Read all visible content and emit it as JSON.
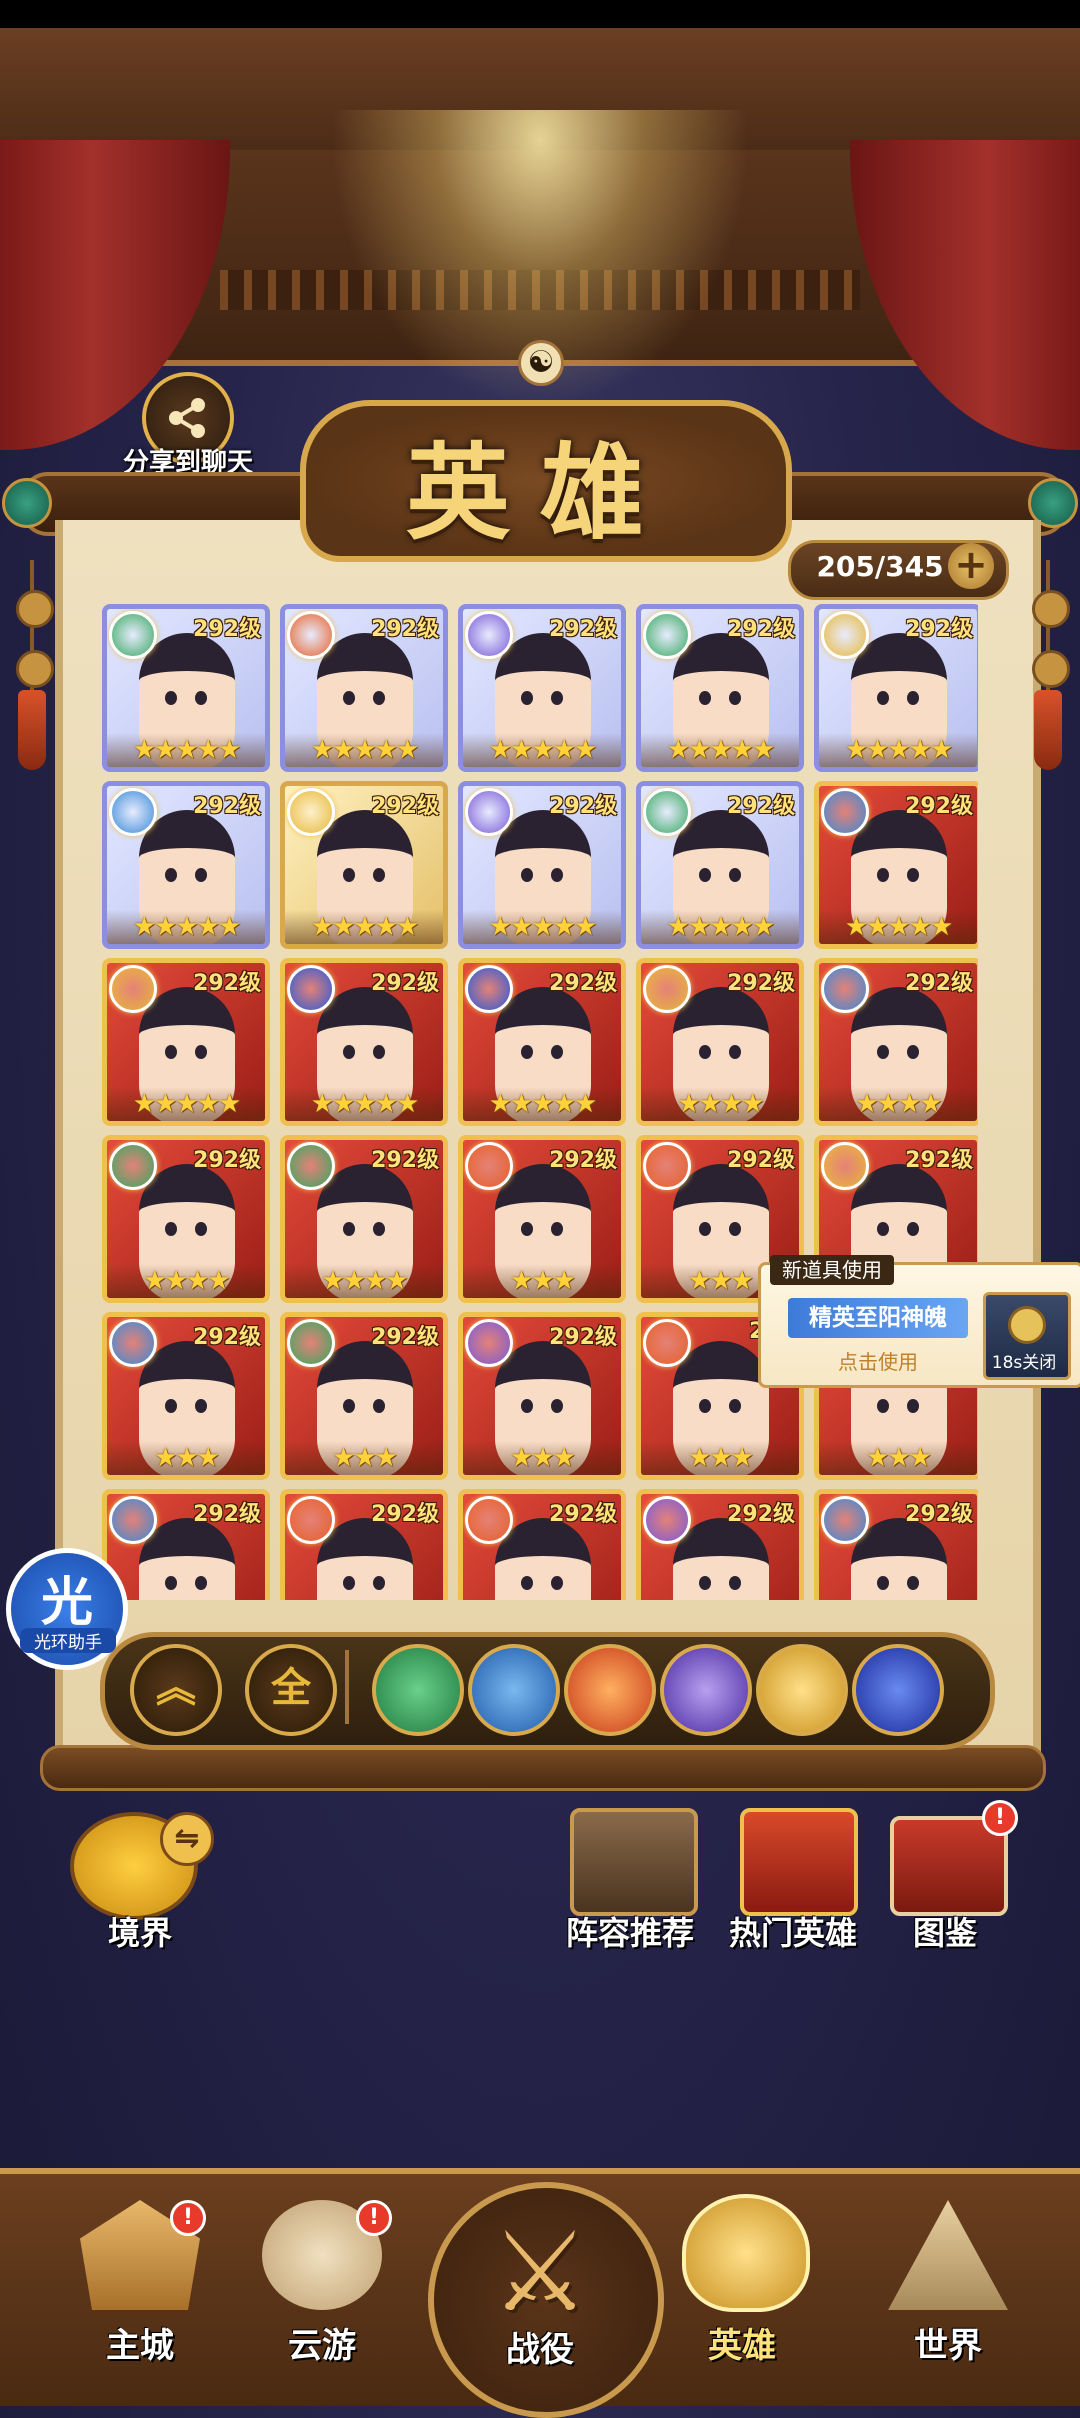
{
  "share": {
    "label": "分享到聊天"
  },
  "panel": {
    "title": "英雄",
    "count": "205/345",
    "plus": "+"
  },
  "heroes": [
    {
      "level": "292级",
      "stars": "★★★★★",
      "frame": "purple",
      "element": "#38a860"
    },
    {
      "level": "292级",
      "stars": "★★★★★",
      "frame": "purple",
      "element": "#e6612a"
    },
    {
      "level": "292级",
      "stars": "★★★★★",
      "frame": "purple",
      "element": "#7a5ad8"
    },
    {
      "level": "292级",
      "stars": "★★★★★",
      "frame": "purple",
      "element": "#38a860"
    },
    {
      "level": "292级",
      "stars": "★★★★★",
      "frame": "purple",
      "element": "#e8b83a"
    },
    {
      "level": "292级",
      "stars": "★★★★★",
      "frame": "purple",
      "element": "#3a8ad8"
    },
    {
      "level": "292级",
      "stars": "★★★★★",
      "frame": "gold",
      "element": "#e8b83a"
    },
    {
      "level": "292级",
      "stars": "★★★★★",
      "frame": "purple",
      "element": "#7a5ad8"
    },
    {
      "level": "292级",
      "stars": "★★★★★",
      "frame": "purple",
      "element": "#38a860"
    },
    {
      "level": "292级",
      "stars": "★★★★★",
      "frame": "red",
      "element": "#3a8ad8"
    },
    {
      "level": "292级",
      "stars": "★★★★★",
      "frame": "red",
      "element": "#e8b83a"
    },
    {
      "level": "292级",
      "stars": "★★★★★",
      "frame": "red",
      "element": "#2a5ad8"
    },
    {
      "level": "292级",
      "stars": "★★★★★",
      "frame": "red",
      "element": "#2a5ad8"
    },
    {
      "level": "292级",
      "stars": "★★★★",
      "frame": "red",
      "element": "#e8b83a"
    },
    {
      "level": "292级",
      "stars": "★★★★",
      "frame": "red",
      "element": "#3a8ad8"
    },
    {
      "level": "292级",
      "stars": "★★★★",
      "frame": "red",
      "element": "#38a860"
    },
    {
      "level": "292级",
      "stars": "★★★★",
      "frame": "red",
      "element": "#38a860"
    },
    {
      "level": "292级",
      "stars": "★★★",
      "frame": "red",
      "element": "#e6612a"
    },
    {
      "level": "292级",
      "stars": "★★★",
      "frame": "red",
      "element": "#e6612a"
    },
    {
      "level": "292级",
      "stars": "★★★",
      "frame": "red",
      "element": "#e8b83a"
    },
    {
      "level": "292级",
      "stars": "★★★",
      "frame": "red",
      "element": "#3a8ad8"
    },
    {
      "level": "292级",
      "stars": "★★★",
      "frame": "red",
      "element": "#38a860"
    },
    {
      "level": "292级",
      "stars": "★★★",
      "frame": "red",
      "element": "#7a5ad8"
    },
    {
      "level": "292",
      "stars": "★★★",
      "frame": "red",
      "element": "#e6612a"
    },
    {
      "level": "",
      "stars": "★★★",
      "frame": "red",
      "element": "#3a8ad8"
    },
    {
      "level": "292级",
      "stars": "",
      "frame": "red",
      "element": "#3a8ad8"
    },
    {
      "level": "292级",
      "stars": "",
      "frame": "red",
      "element": "#e6612a"
    },
    {
      "level": "292级",
      "stars": "",
      "frame": "red",
      "element": "#e6612a"
    },
    {
      "level": "292级",
      "stars": "",
      "frame": "red",
      "element": "#7a5ad8"
    },
    {
      "level": "292级",
      "stars": "",
      "frame": "red",
      "element": "#3a8ad8"
    }
  ],
  "popup": {
    "tag": "新道具使用",
    "item_name": "精英至阳神魄",
    "use": "点击使用",
    "close": "18s关闭"
  },
  "aura": {
    "char": "光",
    "label": "光环助手"
  },
  "filters": {
    "all_label": "全",
    "collapse": "︽"
  },
  "shortcuts": {
    "realm": "境界",
    "lineup": "阵容推荐",
    "hot": "热门英雄",
    "atlas": "图鉴",
    "exclaim": "!"
  },
  "nav": {
    "main_city": "主城",
    "travel": "云游",
    "battle": "战役",
    "heroes": "英雄",
    "world": "世界"
  }
}
